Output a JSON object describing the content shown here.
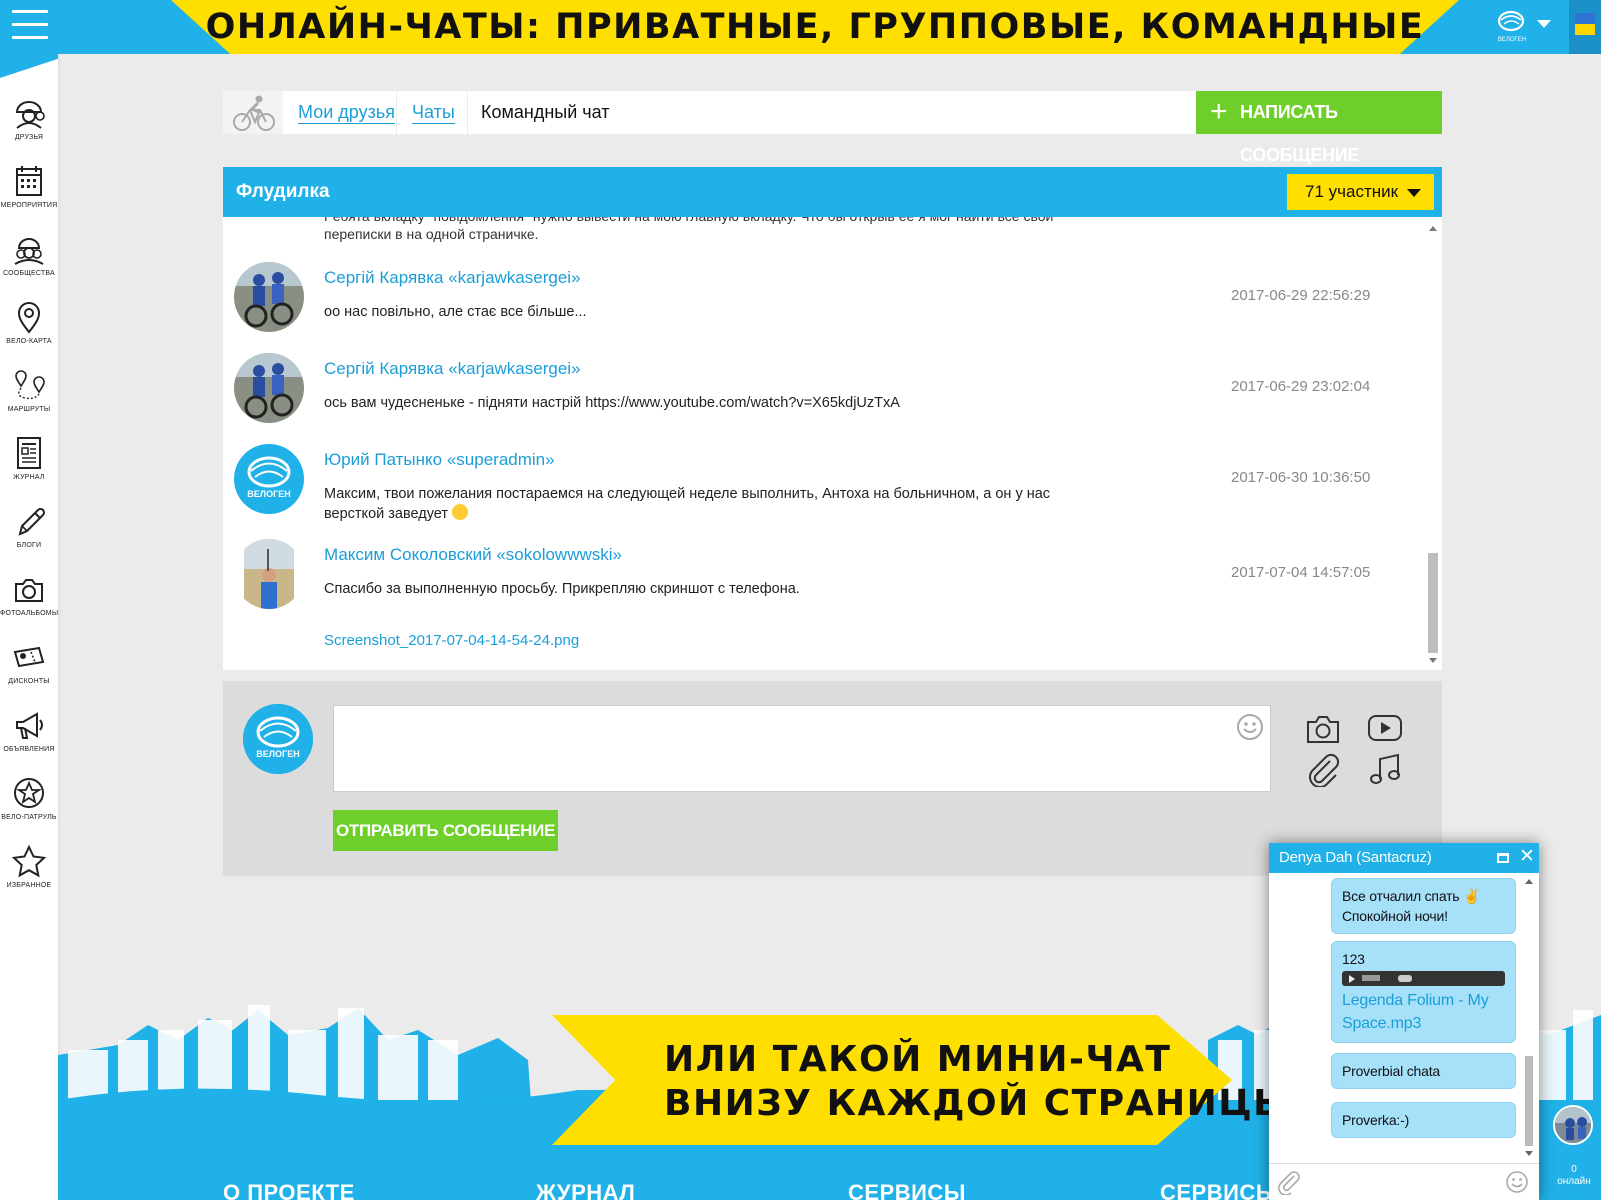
{
  "top_banner": {
    "text": "ОНЛАЙН-ЧАТЫ:   ПРИВАТНЫЕ,   ГРУППОВЫЕ,   КОМАНДНЫЕ"
  },
  "brand": {
    "logo_text": "ВЕЛОГЕН"
  },
  "sidebar": {
    "items": [
      {
        "label": "ДРУЗЬЯ",
        "icon": "friends-icon"
      },
      {
        "label": "МЕРОПРИЯТИЯ",
        "icon": "calendar-icon"
      },
      {
        "label": "СООБЩЕСТВА",
        "icon": "communities-icon"
      },
      {
        "label": "ВЕЛО-КАРТА",
        "icon": "map-pin-icon"
      },
      {
        "label": "МАРШРУТЫ",
        "icon": "routes-icon"
      },
      {
        "label": "ЖУРНАЛ",
        "icon": "journal-icon"
      },
      {
        "label": "БЛОГИ",
        "icon": "pencil-icon"
      },
      {
        "label": "ФОТОАЛЬБОМЫ",
        "icon": "camera-icon"
      },
      {
        "label": "ДИСКОНТЫ",
        "icon": "discount-tag-icon"
      },
      {
        "label": "ОБЪЯВЛЕНИЯ",
        "icon": "megaphone-icon"
      },
      {
        "label": "ВЕЛО-ПАТРУЛЬ",
        "icon": "patrol-badge-icon"
      },
      {
        "label": "ИЗБРАННОЕ",
        "icon": "star-icon"
      }
    ]
  },
  "breadcrumb": {
    "friends": "Мои друзья",
    "chats": "Чаты",
    "current": "Командный чат"
  },
  "write_button": {
    "plus": "+",
    "label": "НАПИСАТЬ СООБЩЕНИЕ"
  },
  "chat": {
    "title": "Флудилка",
    "members": "71 участник",
    "top_cut_text": "Ребята вкладку \"повідомлення\" нужно вывести на мою главную вкладку. Что бы открыв её я мог найти все свои",
    "top_cut_text2": "переписки в на одной страничке.",
    "messages": [
      {
        "author": "Сергій Карявка «karjawkasergei»",
        "time": "2017-06-29 22:56:29",
        "text": "оо нас повільно, але стає все більше..."
      },
      {
        "author": "Сергій Карявка «karjawkasergei»",
        "time": "2017-06-29 23:02:04",
        "text": "ось вам чудесненьке - підняти настрій https://www.youtube.com/watch?v=X65kdjUzTxA"
      },
      {
        "author": "Юрий Патынко «superadmin»",
        "time": "2017-06-30 10:36:50",
        "text": "Максим, твои пожелания постараемся на следующей неделе выполнить, Антоха на больничном, а он у нас версткой заведует"
      },
      {
        "author": "Максим Соколовский «sokolowwwski»",
        "time": "2017-07-04 14:57:05",
        "text": "Спасибо за выполненную просьбу. Прикрепляю скриншот с телефона."
      }
    ],
    "attachment": "Screenshot_2017-07-04-14-54-24.png"
  },
  "composer": {
    "placeholder": "",
    "send_label": "ОТПРАВИТЬ СООБЩЕНИЕ"
  },
  "bottom_banner": {
    "line1": "ИЛИ ТАКОЙ МИНИ-ЧАТ",
    "line2": "ВНИЗУ КАЖДОЙ СТРАНИЦЫ"
  },
  "footer": {
    "columns": [
      "О ПРОЕКТЕ",
      "ЖУРНАЛ",
      "СЕРВИСЫ",
      "СЕРВИСЫ"
    ]
  },
  "mini_chat": {
    "title": "Denya Dah (Santacruz)",
    "messages": [
      {
        "line1": "Все отчалил спать ✌",
        "line2": "Спокойной ночи!"
      },
      {
        "line1": "123",
        "file": "Legenda Folium - My Space.mp3"
      },
      {
        "line1": "Proverbial chata"
      },
      {
        "line1": "Proverka:-)"
      }
    ],
    "input_placeholder": ""
  },
  "online": {
    "count": "0",
    "label": "онлайн"
  },
  "colors": {
    "primary": "#1fb1e8",
    "accent": "#ffdf00",
    "action": "#6fcf2a",
    "link": "#1b9ed8"
  }
}
